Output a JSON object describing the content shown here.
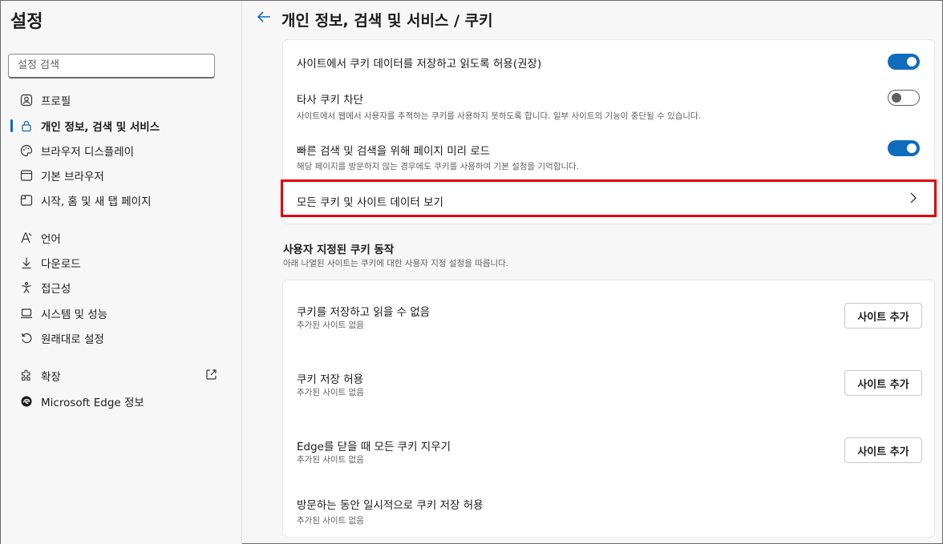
{
  "sidebar": {
    "title": "설정",
    "search_placeholder": "설정 검색",
    "items": [
      {
        "label": "프로필",
        "icon": "profile-icon"
      },
      {
        "label": "개인 정보, 검색 및 서비스",
        "icon": "lock-icon",
        "active": true
      },
      {
        "label": "브라우저 디스플레이",
        "icon": "palette-icon"
      },
      {
        "label": "기본 브라우저",
        "icon": "browser-icon"
      },
      {
        "label": "시작, 홈 및 새 탭 페이지",
        "icon": "home-tab-icon"
      },
      {
        "label": "언어",
        "icon": "language-icon"
      },
      {
        "label": "다운로드",
        "icon": "download-icon"
      },
      {
        "label": "접근성",
        "icon": "accessibility-icon"
      },
      {
        "label": "시스템 및 성능",
        "icon": "laptop-icon"
      },
      {
        "label": "원래대로 설정",
        "icon": "reset-icon"
      },
      {
        "label": "확장",
        "icon": "extensions-icon"
      },
      {
        "label": "Microsoft Edge 정보",
        "icon": "edge-icon"
      }
    ]
  },
  "header": {
    "title": "개인 정보, 검색 및 서비스 / 쿠키"
  },
  "cookies": {
    "allow_label": "사이트에서 쿠키 데이터를 저장하고 읽도록 허용(권장)",
    "third_party_label": "타사 쿠키 차단",
    "third_party_desc": "사이트에서 웹에서 사용자를 추적하는 쿠키를 사용하지 못하도록 합니다. 일부 사이트의 기능이 중단될 수 있습니다.",
    "preload_label": "빠른 검색 및 검색을 위해 페이지 미리 로드",
    "preload_desc": "해당 페이지를 방문하지 않는 경우에도 쿠키를 사용하여 기본 설정을 기억합니다.",
    "see_all_label": "모든 쿠키 및 사이트 데이터 보기",
    "toggles": {
      "allow": true,
      "third_party": false,
      "preload": true
    }
  },
  "custom": {
    "title": "사용자 지정된 쿠키 동작",
    "desc": "아래 나열된 사이트는 쿠키에 대한 사용자 지정 설정을 따릅니다.",
    "block_label": "쿠키를 저장하고 읽을 수 없음",
    "block_sub": "추가된 사이트 없음",
    "allow_label": "쿠키 저장 허용",
    "allow_sub": "추가된 사이트 없음",
    "clear_label": "Edge를 닫을 때 모든 쿠키 지우기",
    "clear_sub": "추가된 사이트 없음",
    "session_label": "방문하는 동안 일시적으로 쿠키 저장 허용",
    "session_sub": "추가된 사이트 없음",
    "add_button": "사이트 추가"
  },
  "colors": {
    "accent": "#0f6cbd",
    "highlight": "#e0000a"
  }
}
